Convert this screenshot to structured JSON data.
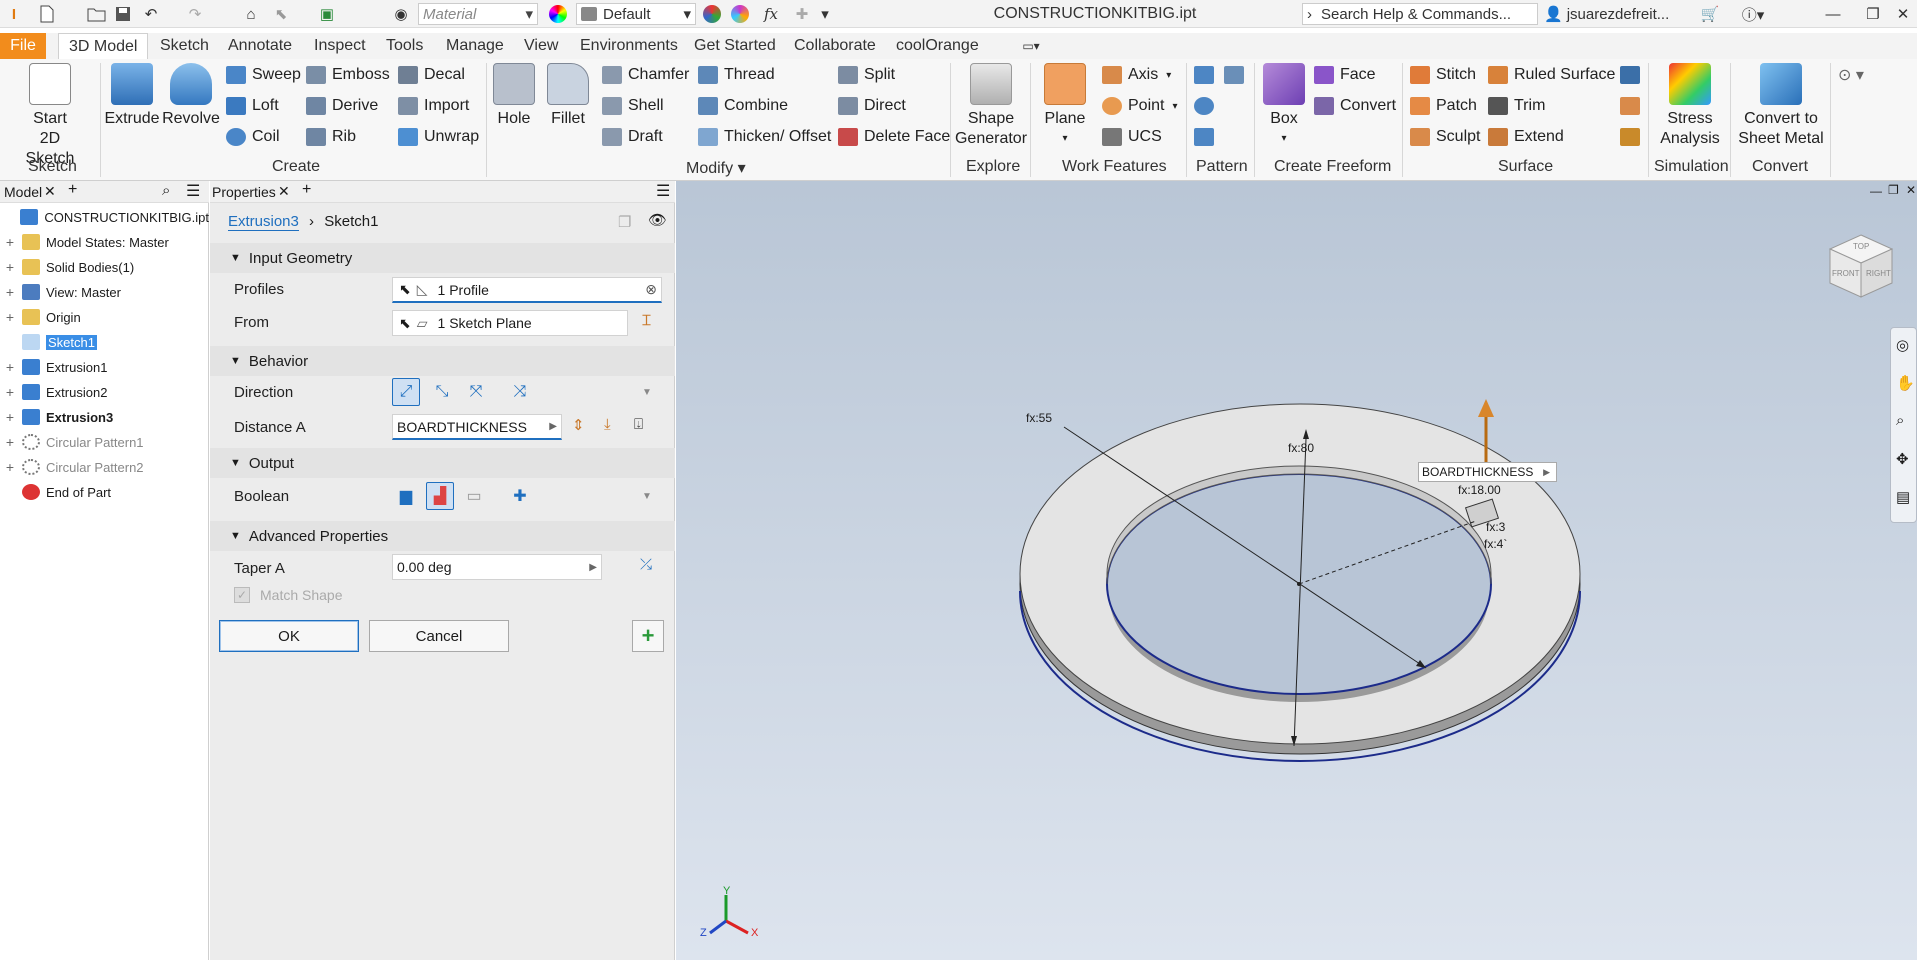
{
  "app": {
    "file_title": "CONSTRUCTIONKITBIG.ipt",
    "material_placeholder": "Material",
    "appearance_value": "Default",
    "search_placeholder": "Search Help & Commands...",
    "username": "jsuarezdefreit...",
    "fx_label": "fx"
  },
  "tabs": [
    "File",
    "3D Model",
    "Sketch",
    "Annotate",
    "Inspect",
    "Tools",
    "Manage",
    "View",
    "Environments",
    "Get Started",
    "Collaborate",
    "coolOrange"
  ],
  "ribbon": {
    "sketch": {
      "start_line1": "Start",
      "start_line2": "2D Sketch",
      "panel": "Sketch"
    },
    "create": {
      "extrude": "Extrude",
      "revolve": "Revolve",
      "sweep": "Sweep",
      "emboss": "Emboss",
      "decal": "Decal",
      "loft": "Loft",
      "derive": "Derive",
      "import": "Import",
      "coil": "Coil",
      "rib": "Rib",
      "unwrap": "Unwrap",
      "panel": "Create"
    },
    "modify": {
      "hole": "Hole",
      "fillet": "Fillet",
      "chamfer": "Chamfer",
      "thread": "Thread",
      "split": "Split",
      "shell": "Shell",
      "combine": "Combine",
      "direct": "Direct",
      "draft": "Draft",
      "thicken": "Thicken/ Offset",
      "delete_face": "Delete Face",
      "panel": "Modify"
    },
    "explore": {
      "shape_line1": "Shape",
      "shape_line2": "Generator",
      "panel": "Explore"
    },
    "work": {
      "plane": "Plane",
      "axis": "Axis",
      "point": "Point",
      "ucs": "UCS",
      "panel": "Work Features"
    },
    "pattern": {
      "panel": "Pattern"
    },
    "freeform": {
      "box": "Box",
      "face": "Face",
      "convert": "Convert",
      "panel": "Create Freeform"
    },
    "surface": {
      "stitch": "Stitch",
      "ruled": "Ruled Surface",
      "patch": "Patch",
      "trim": "Trim",
      "sculpt": "Sculpt",
      "extend": "Extend",
      "panel": "Surface"
    },
    "simulation": {
      "line1": "Stress",
      "line2": "Analysis",
      "panel": "Simulation"
    },
    "convert": {
      "line1": "Convert to",
      "line2": "Sheet Metal",
      "panel": "Convert"
    }
  },
  "browser": {
    "tab": "Model",
    "items": [
      {
        "label": "CONSTRUCTIONKITBIG.ipt",
        "kind": "part"
      },
      {
        "label": "Model States: Master",
        "kind": "folder"
      },
      {
        "label": "Solid Bodies(1)",
        "kind": "folder"
      },
      {
        "label": "View: Master",
        "kind": "view"
      },
      {
        "label": "Origin",
        "kind": "folder"
      },
      {
        "label": "Sketch1",
        "kind": "sketch"
      },
      {
        "label": "Extrusion1",
        "kind": "extrusion"
      },
      {
        "label": "Extrusion2",
        "kind": "extrusion"
      },
      {
        "label": "Extrusion3",
        "kind": "extrusion"
      },
      {
        "label": "Circular Pattern1",
        "kind": "pattern"
      },
      {
        "label": "Circular Pattern2",
        "kind": "pattern"
      },
      {
        "label": "End of Part",
        "kind": "end"
      }
    ]
  },
  "properties": {
    "tab": "Properties",
    "crumb1": "Extrusion3",
    "crumb2": "Sketch1",
    "input_geometry": "Input Geometry",
    "profiles_label": "Profiles",
    "profiles_value": "1 Profile",
    "from_label": "From",
    "from_value": "1 Sketch Plane",
    "behavior": "Behavior",
    "direction_label": "Direction",
    "distance_label": "Distance A",
    "distance_value": "BOARDTHICKNESS",
    "output": "Output",
    "boolean_label": "Boolean",
    "advanced": "Advanced Properties",
    "taper_label": "Taper A",
    "taper_value": "0.00 deg",
    "match_shape": "Match Shape",
    "ok": "OK",
    "cancel": "Cancel"
  },
  "viewport": {
    "dim_55": "fx:55",
    "dim_80": "fx:80",
    "dim_18": "fx:18.00",
    "dim_3": "fx:3",
    "dim_4": "fx:4`",
    "tooltip": "BOARDTHICKNESS",
    "cube_top": "TOP",
    "cube_front": "FRONT",
    "cube_right": "RIGHT",
    "axis_x": "X",
    "axis_y": "Y",
    "axis_z": "Z"
  }
}
